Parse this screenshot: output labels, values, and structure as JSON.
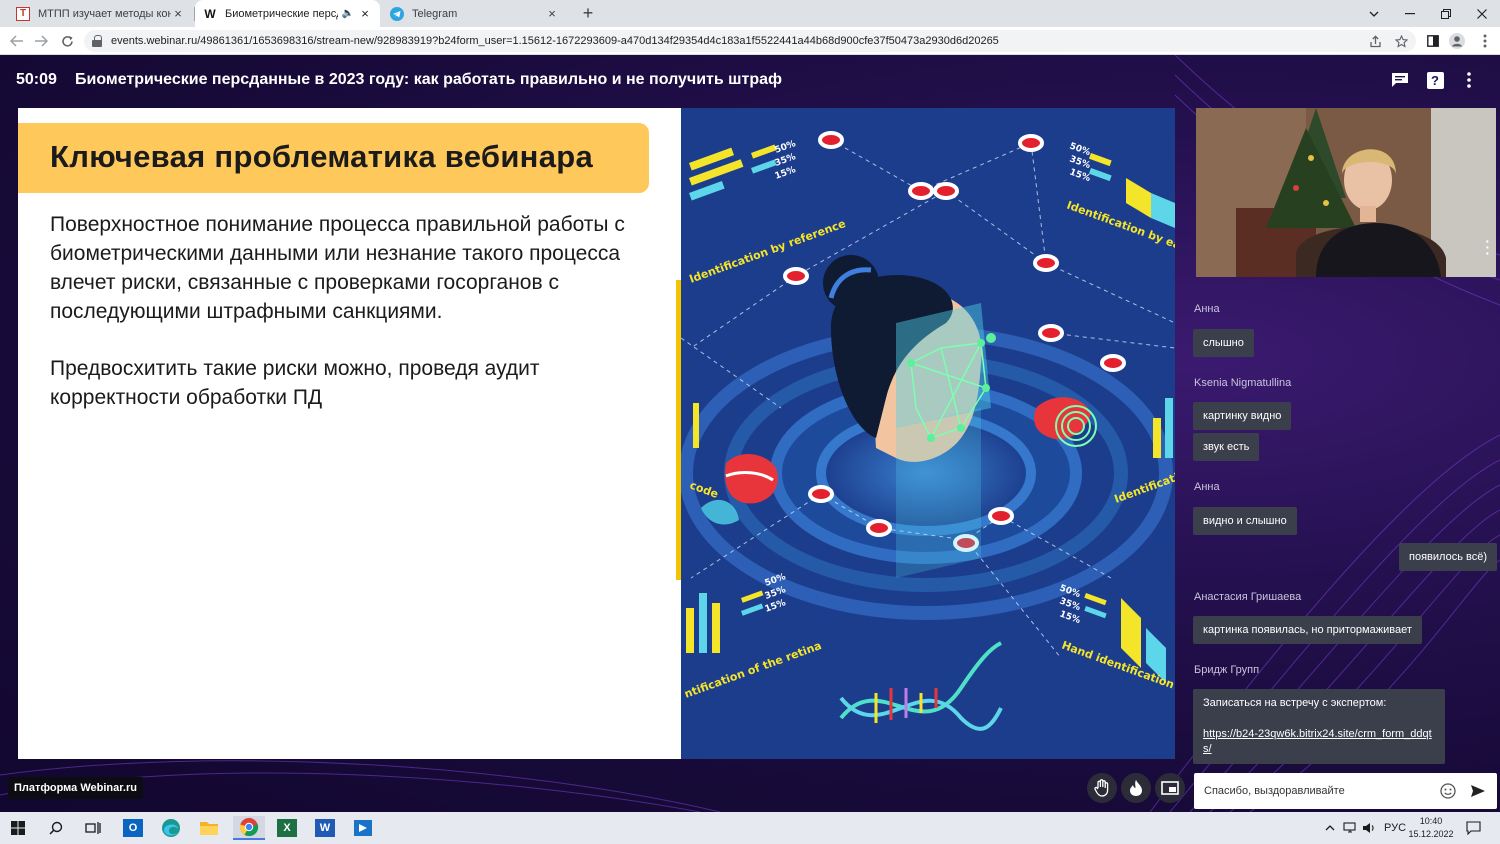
{
  "browser": {
    "tabs": [
      {
        "title": "МТПП изучает методы контро",
        "favicon": "T",
        "close": "×"
      },
      {
        "title": "Биометрические персданные",
        "favicon": "W",
        "close": "×",
        "audio": "🔈"
      },
      {
        "title": "Telegram",
        "favicon": "telegram-icon",
        "close": "×"
      }
    ],
    "new_tab": "+",
    "url": "events.webinar.ru/49861361/1653698316/stream-new/928983919?b24form_user=1.15612-1672293609-a470d134f29354d4c183a1f5522441a44b68d900cfe37f50473a2930d6d20265"
  },
  "webinar": {
    "timer": "50:09",
    "title": "Биометрические персданные в 2023 году: как работать правильно и не получить штраф",
    "slide": {
      "heading": "Ключевая проблематика вебинара",
      "paragraph1": "Поверхностное понимание процесса правильной работы с биометрическими данными или незнание такого процесса влечет риски, связанные с проверками госорганов с последующими штрафными санкциями.",
      "paragraph2": "Предвосхитить такие риски можно, проведя аудит корректности обработки ПД",
      "art": {
        "label_reference": "Identification by reference",
        "label_ear": "Identification by ear",
        "label_code": "code",
        "label_ident": "Identification",
        "label_retina": "ntification of the retina",
        "label_hand": "Hand identification",
        "pct1": "50%",
        "pct2": "35%",
        "pct3": "15%"
      }
    },
    "chat": {
      "messages": [
        {
          "author": "Анна",
          "text": "слышно"
        },
        {
          "author": "Ksenia Nigmatullina",
          "text": "картинку видно"
        },
        {
          "author": "",
          "text": "звук есть"
        },
        {
          "author": "Анна",
          "text": "видно и слышно"
        },
        {
          "author": "",
          "text": "появилось всё)",
          "own": true
        },
        {
          "author": "Анастасия Гришаева",
          "text": "картинка появилась, но притормаживает"
        },
        {
          "author": "Бридж Групп",
          "text": "Записаться на встречу с экспертом:",
          "link": "https://b24-23qw6k.bitrix24.site/crm_form_ddqts/"
        }
      ],
      "input_placeholder": "Спасибо, выздоравливайте"
    },
    "platform_badge": "Платформа Webinar.ru",
    "help_label": "?"
  },
  "taskbar": {
    "lang": "РУС",
    "time": "10:40",
    "date": "15.12.2022",
    "outlook_label": "O",
    "excel_label": "X",
    "word_label": "W"
  },
  "colors": {
    "banner": "#ffc85a",
    "accent_bar": "#f5c400",
    "chat_bubble": "#3a3f4b",
    "app_bg": "#1a0b3d"
  }
}
